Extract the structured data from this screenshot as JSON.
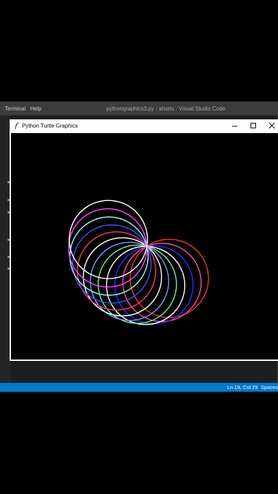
{
  "vscode": {
    "menu": [
      "Terminal",
      "Help"
    ],
    "window_title": "pythongraphics3.py - shorts - Visual Studio Code",
    "status": {
      "position": "Ln 19, Col 29",
      "spaces": "Spaces:"
    }
  },
  "turtle_window": {
    "title": "Python Turtle Graphics",
    "controls": [
      "minimize-icon",
      "maximize-icon",
      "close-icon"
    ]
  },
  "drawing": {
    "background": "#000000",
    "circle_colors": [
      "#ff2a2a",
      "#ff44aa",
      "#2a2aff",
      "#ffffff",
      "#55ff99",
      "#7799ff",
      "#ffffff",
      "#ff3366",
      "#3355ff",
      "#99ffff",
      "#ff44ff",
      "#ffffff"
    ]
  }
}
